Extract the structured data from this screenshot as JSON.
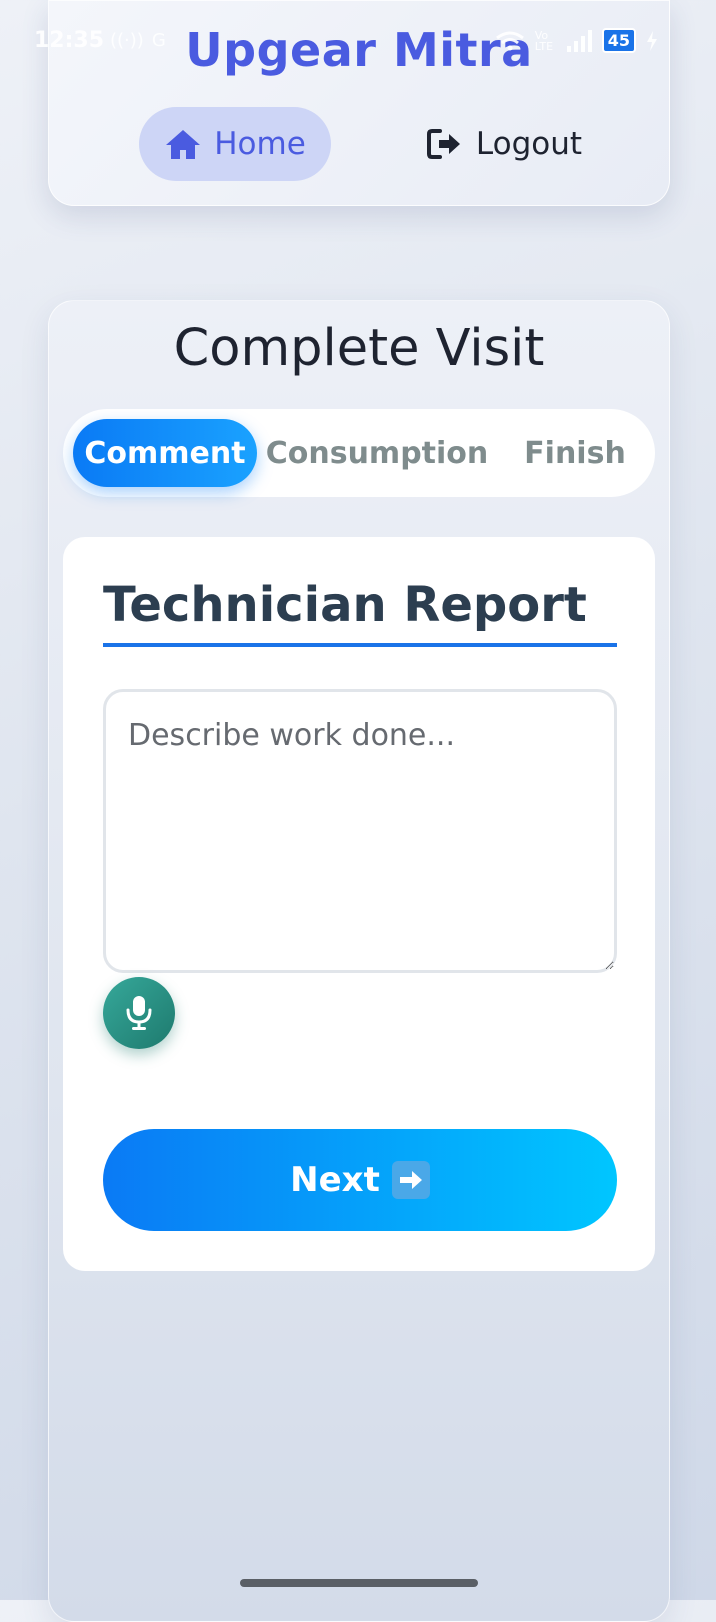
{
  "status_bar": {
    "time": "12:35",
    "battery_level": "45",
    "network_label": "Vo LTE"
  },
  "header": {
    "app_title": "Upgear Mitra",
    "nav": {
      "home_label": "Home",
      "logout_label": "Logout"
    }
  },
  "visit": {
    "page_title": "Complete Visit",
    "tabs": [
      {
        "label": "Comment",
        "active": true
      },
      {
        "label": "Consumption",
        "active": false
      },
      {
        "label": "Finish",
        "active": false
      }
    ],
    "form": {
      "section_title": "Technician Report",
      "report_value": "",
      "report_placeholder": "Describe work done...",
      "next_label": "Next"
    }
  },
  "colors": {
    "brand": "#4a5be0",
    "accent": "#1a73e8",
    "mic": "#2a9486"
  },
  "icons": {
    "home": "home-icon",
    "logout": "logout-icon",
    "mic": "microphone-icon",
    "next": "arrow-right-icon"
  }
}
